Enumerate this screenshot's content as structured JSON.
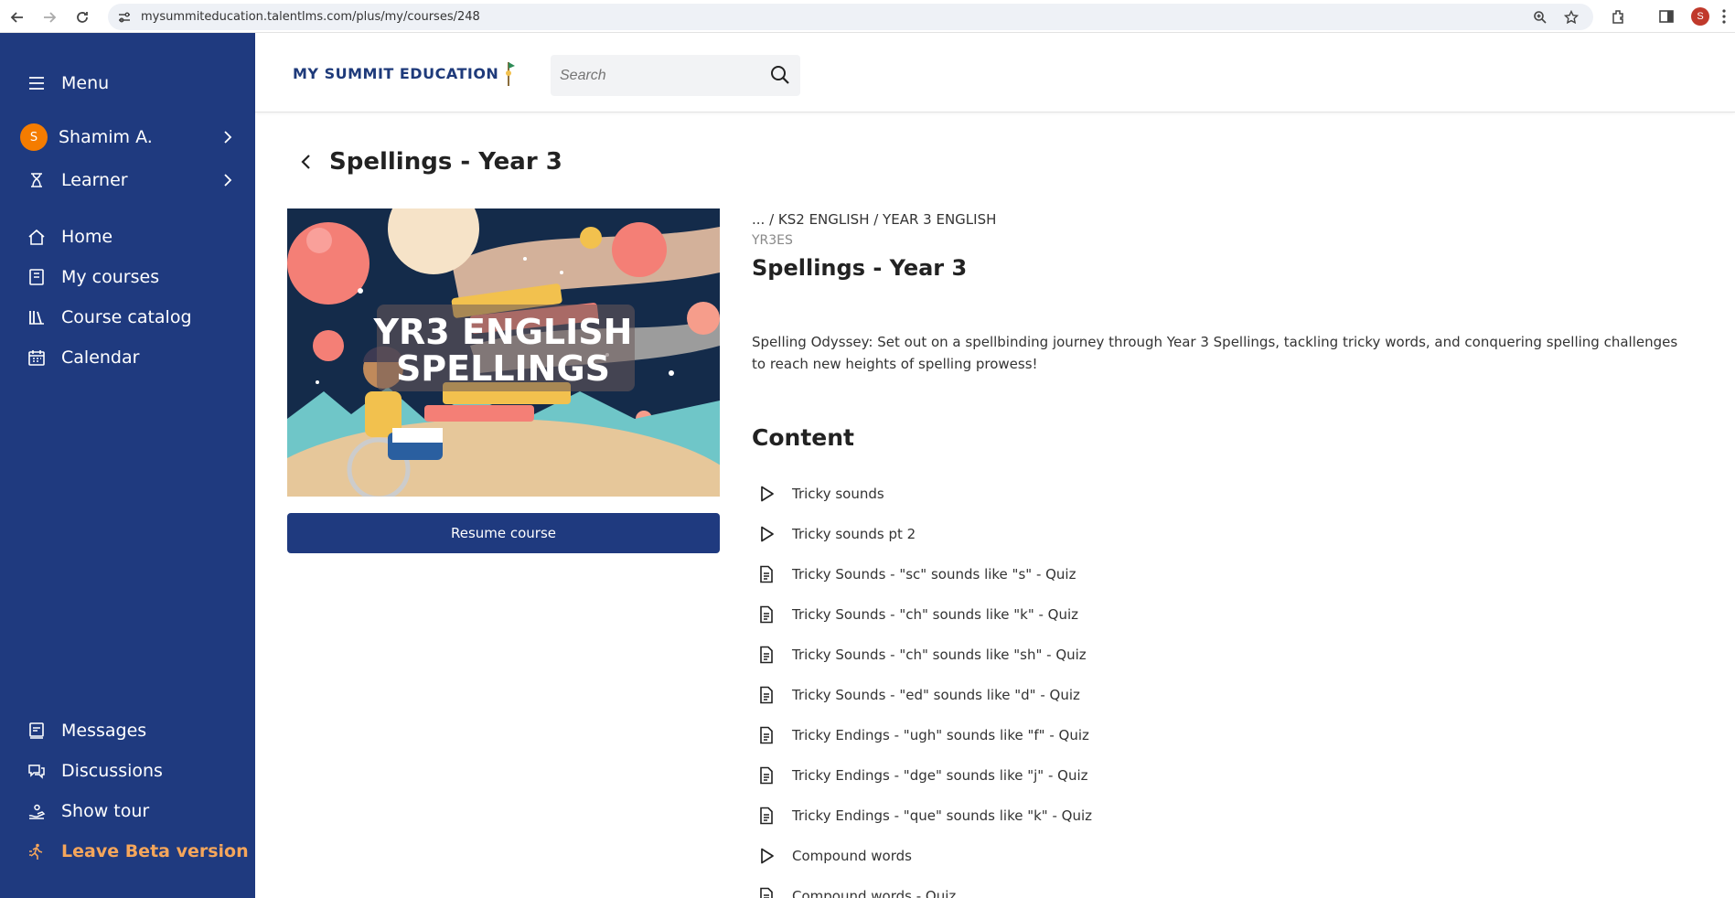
{
  "browser": {
    "url": "mysummiteducation.talentlms.com/plus/my/courses/248",
    "profile_initial": "S"
  },
  "sidebar": {
    "menu_label": "Menu",
    "user": {
      "initial": "S",
      "name": "Shamim A."
    },
    "role_label": "Learner",
    "nav": [
      {
        "label": "Home",
        "icon": "home-icon"
      },
      {
        "label": "My courses",
        "icon": "book-icon"
      },
      {
        "label": "Course catalog",
        "icon": "catalog-icon"
      },
      {
        "label": "Calendar",
        "icon": "calendar-icon"
      }
    ],
    "bottom": [
      {
        "label": "Messages",
        "icon": "messages-icon"
      },
      {
        "label": "Discussions",
        "icon": "discussions-icon"
      },
      {
        "label": "Show tour",
        "icon": "tour-icon"
      },
      {
        "label": "Leave Beta version",
        "icon": "leave-beta-icon"
      }
    ]
  },
  "header": {
    "logo_text": "MY SUMMIT EDUCATION",
    "search_placeholder": "Search"
  },
  "course": {
    "page_title": "Spellings - Year 3",
    "image_text_line1": "YR3 ENGLISH",
    "image_text_line2": "SPELLINGS",
    "resume_label": "Resume course",
    "breadcrumb": "... / KS2 ENGLISH / YEAR 3 ENGLISH",
    "code": "YR3ES",
    "title": "Spellings - Year 3",
    "description": "Spelling Odyssey: Set out on a spellbinding journey through Year 3 Spellings, tackling tricky words, and conquering spelling challenges to reach new heights of spelling prowess!",
    "content_heading": "Content",
    "content": [
      {
        "label": "Tricky sounds",
        "type": "video"
      },
      {
        "label": "Tricky sounds pt 2",
        "type": "video"
      },
      {
        "label": "Tricky Sounds - \"sc\" sounds like \"s\" - Quiz",
        "type": "quiz"
      },
      {
        "label": "Tricky Sounds - \"ch\" sounds like \"k\" - Quiz",
        "type": "quiz"
      },
      {
        "label": "Tricky Sounds - \"ch\" sounds like \"sh\" - Quiz",
        "type": "quiz"
      },
      {
        "label": "Tricky Sounds - \"ed\" sounds like \"d\" - Quiz",
        "type": "quiz"
      },
      {
        "label": "Tricky Endings - \"ugh\" sounds like \"f\" - Quiz",
        "type": "quiz"
      },
      {
        "label": "Tricky Endings - \"dge\" sounds like \"j\" - Quiz",
        "type": "quiz"
      },
      {
        "label": "Tricky Endings - \"que\" sounds like \"k\" - Quiz",
        "type": "quiz"
      },
      {
        "label": "Compound words",
        "type": "video"
      },
      {
        "label": "Compound words - Quiz",
        "type": "quiz"
      }
    ]
  },
  "colors": {
    "sidebar_bg": "#1f3a7f",
    "accent_orange": "#f5a65b",
    "button_bg": "#1f3a7f"
  }
}
